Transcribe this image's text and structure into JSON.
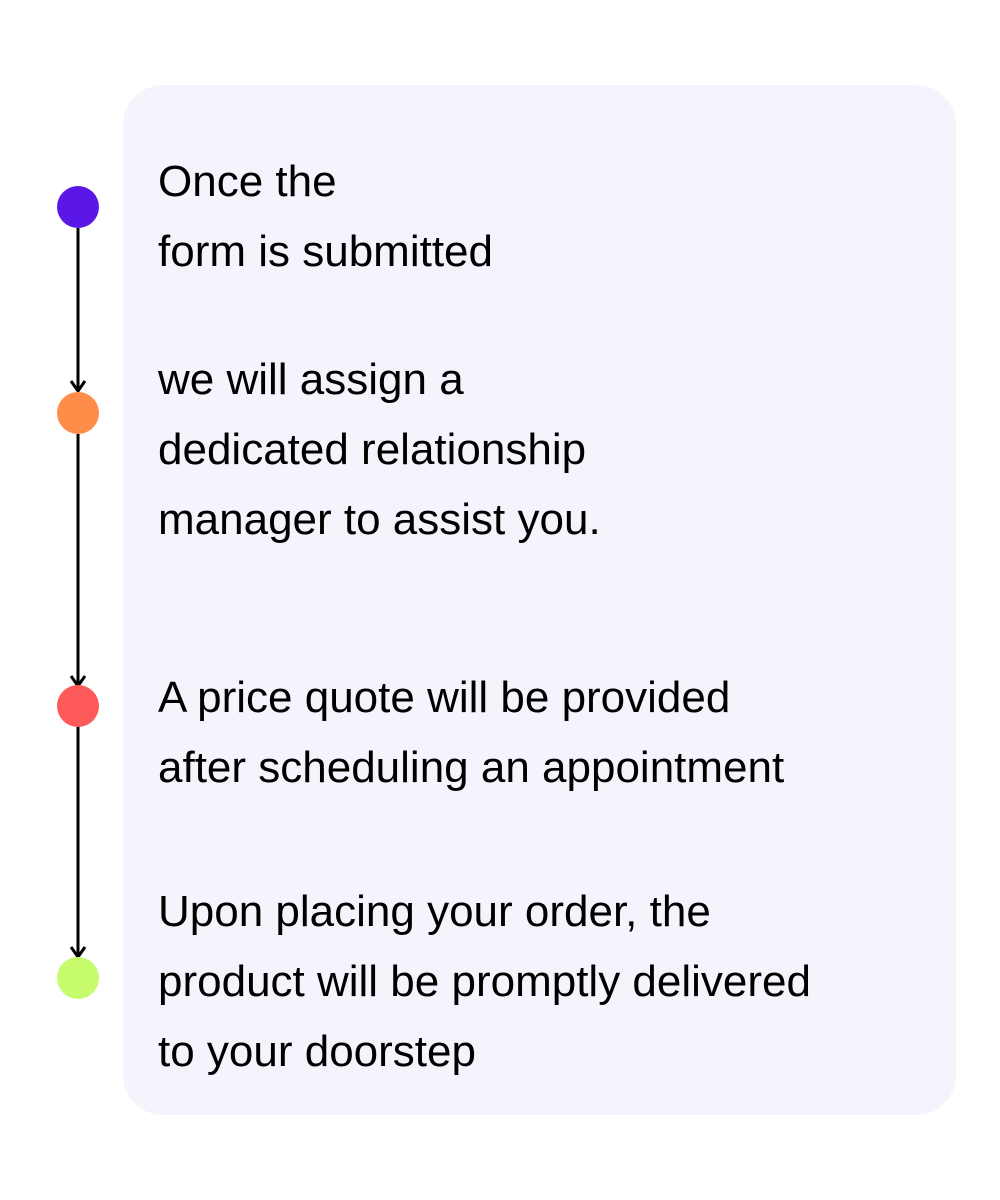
{
  "colors": {
    "card_background": "#f5f4fd",
    "connector": "#000000",
    "text": "#000000"
  },
  "steps": [
    {
      "dot_color": "#5b17e8",
      "lines": [
        "Once the",
        "form is submitted"
      ]
    },
    {
      "dot_color": "#ff8c48",
      "lines": [
        "we will assign a",
        "dedicated relationship",
        "manager to assist you."
      ]
    },
    {
      "dot_color": "#ff5a5a",
      "lines": [
        "A price quote will be provided",
        "after scheduling an appointment"
      ]
    },
    {
      "dot_color": "#c6fc6b",
      "lines": [
        "Upon placing your order, the",
        "product will be promptly delivered",
        "to your doorstep"
      ]
    }
  ]
}
